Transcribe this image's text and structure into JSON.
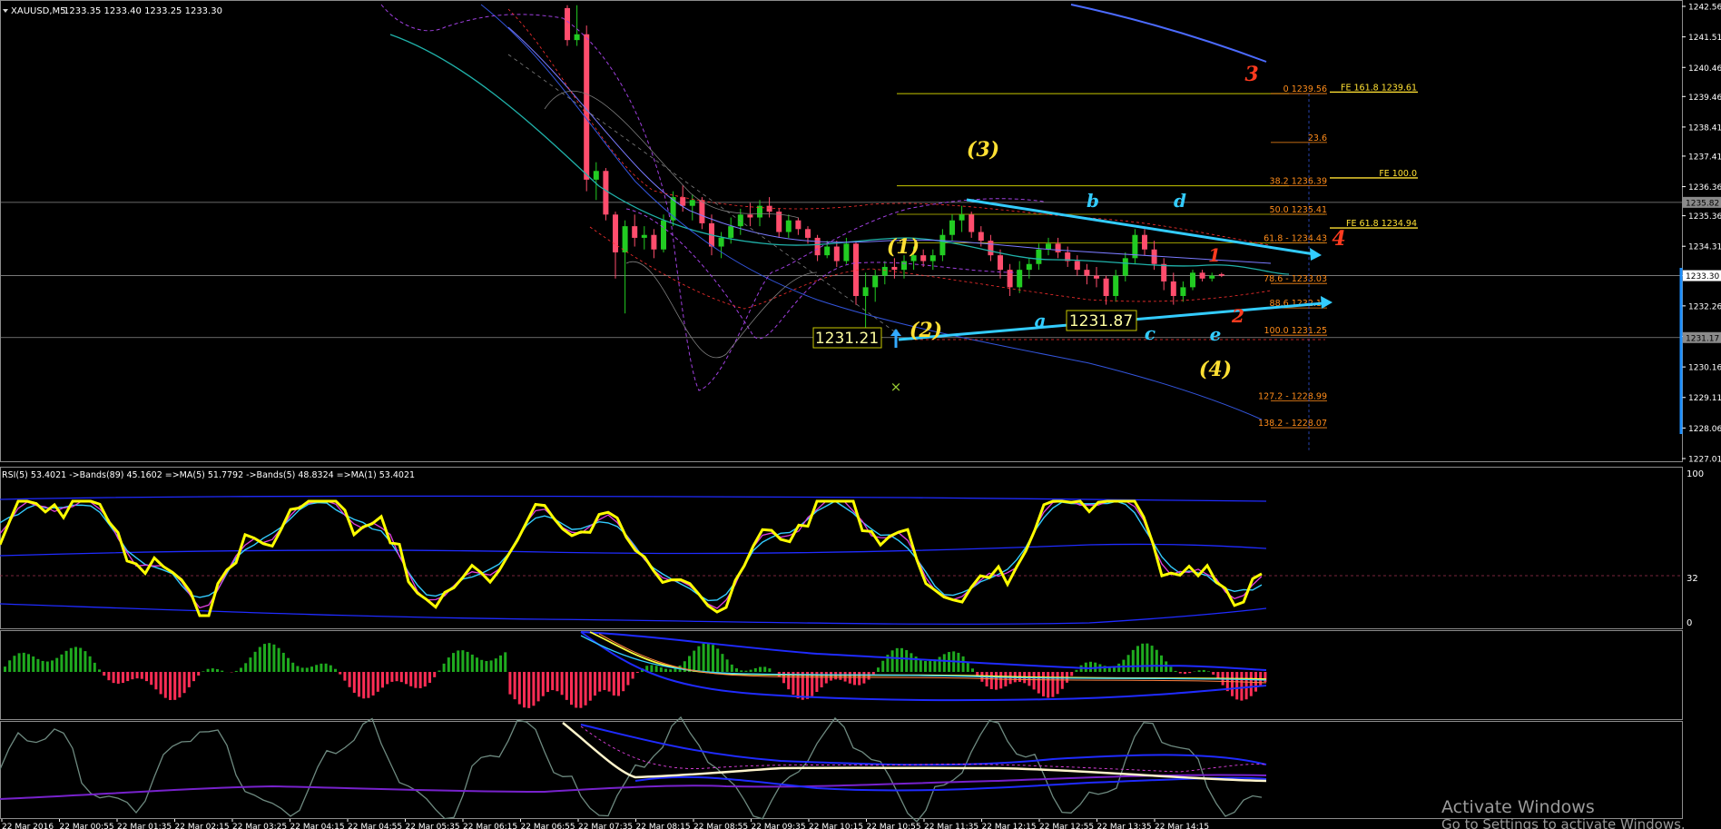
{
  "header": {
    "symbol": "XAUUSD,M5",
    "ohlc": "1233.35 1233.40 1233.25 1233.30"
  },
  "price_axis": {
    "ticks": [
      "1242.56",
      "1241.51",
      "1240.46",
      "1239.46",
      "1238.41",
      "1237.41",
      "1236.36",
      "1235.36",
      "1234.31",
      "1233.30",
      "1232.26",
      "1231.21",
      "1230.16",
      "1229.11",
      "1228.06",
      "1227.01"
    ],
    "current_price_tag": "1233.30",
    "line_tags": [
      "1235.82",
      "1231.17"
    ]
  },
  "fib_retracement": {
    "levels": [
      {
        "label": "0 1239.56",
        "price": 1239.56
      },
      {
        "label": "23.6",
        "price": 1237.88
      },
      {
        "label": "38.2 1236.39",
        "price": 1236.39
      },
      {
        "label": "50.0 1235.41",
        "price": 1235.41
      },
      {
        "label": "61.8 - 1234.43",
        "price": 1234.43
      },
      {
        "label": "78.6 - 1233.03",
        "price": 1233.03
      },
      {
        "label": "88.6 1232.19",
        "price": 1232.19
      },
      {
        "label": "100.0 1231.25",
        "price": 1231.25
      },
      {
        "label": "127.2 - 1228.99",
        "price": 1228.99
      },
      {
        "label": "138.2 - 1228.07",
        "price": 1228.07
      }
    ]
  },
  "fib_expansion": [
    {
      "label": "FE 161.8 1239.61",
      "price": 1239.61
    },
    {
      "label": "FE 100.0",
      "price": 1236.66
    },
    {
      "label": "FE 61.8 1234.94",
      "price": 1234.94
    }
  ],
  "wave_labels": {
    "yellow": [
      "(3)",
      "(1)",
      "(2)",
      "(4)"
    ],
    "cyan": [
      "b",
      "d",
      "a",
      "c",
      "e"
    ],
    "red": [
      "3",
      "4",
      "1",
      "2"
    ]
  },
  "price_boxes": [
    "1231.21",
    "1231.87"
  ],
  "rsi_panel": {
    "legend": "RSI(5) 53.4021 ->Bands(89) 45.1602 =>MA(5) 51.7792 ->Bands(5) 48.8324 =>MA(1) 53.4021",
    "scale": [
      "100",
      "32",
      "0"
    ]
  },
  "time_axis": {
    "labels": [
      "22 Mar 2016",
      "22 Mar 00:55",
      "22 Mar 01:35",
      "22 Mar 02:15",
      "22 Mar 03:25",
      "22 Mar 04:15",
      "22 Mar 04:55",
      "22 Mar 05:35",
      "22 Mar 06:15",
      "22 Mar 06:55",
      "22 Mar 07:35",
      "22 Mar 08:15",
      "22 Mar 08:55",
      "22 Mar 09:35",
      "22 Mar 10:15",
      "22 Mar 10:55",
      "22 Mar 11:35",
      "22 Mar 12:15",
      "22 Mar 12:55",
      "22 Mar 13:35",
      "22 Mar 14:15"
    ]
  },
  "watermark": {
    "line1": "Activate Windows",
    "line2": "Go to Settings to activate Windows."
  },
  "colors": {
    "background": "#000000",
    "bull": "#22cc22",
    "bear": "#ff4d6d",
    "rsi": "#ffff00",
    "cyan": "#33ccff",
    "fib_line": "#c8c800",
    "fib_text": "#ff8c1a",
    "band": "#1f2bff",
    "wave_yellow": "#ffe033",
    "wave_red": "#ff3b1f"
  },
  "chart_data": {
    "type": "candlestick",
    "title": "XAUUSD,M5",
    "ylim": [
      1227.01,
      1242.56
    ],
    "candles": [
      [
        1242.5,
        1242.6,
        1241.2,
        1241.4
      ],
      [
        1241.4,
        1242.6,
        1241.2,
        1241.6
      ],
      [
        1241.6,
        1241.9,
        1236.2,
        1236.6
      ],
      [
        1236.6,
        1237.2,
        1235.9,
        1236.9
      ],
      [
        1236.9,
        1237.0,
        1235.2,
        1235.4
      ],
      [
        1235.4,
        1235.5,
        1233.2,
        1234.1
      ],
      [
        1234.1,
        1235.2,
        1232.0,
        1235.0
      ],
      [
        1235.0,
        1235.4,
        1234.3,
        1234.6
      ],
      [
        1234.6,
        1235.0,
        1234.2,
        1234.7
      ],
      [
        1234.7,
        1234.9,
        1233.9,
        1234.2
      ],
      [
        1234.2,
        1235.4,
        1234.1,
        1235.2
      ],
      [
        1235.2,
        1236.2,
        1235.0,
        1236.0
      ],
      [
        1236.0,
        1236.4,
        1235.5,
        1235.7
      ],
      [
        1235.7,
        1236.1,
        1235.2,
        1235.9
      ],
      [
        1235.9,
        1236.0,
        1234.9,
        1235.1
      ],
      [
        1235.1,
        1235.4,
        1234.0,
        1234.3
      ],
      [
        1234.3,
        1234.8,
        1233.9,
        1234.6
      ],
      [
        1234.6,
        1235.3,
        1234.4,
        1235.0
      ],
      [
        1235.0,
        1235.6,
        1234.7,
        1235.4
      ],
      [
        1235.4,
        1235.8,
        1235.0,
        1235.3
      ],
      [
        1235.3,
        1235.9,
        1235.0,
        1235.7
      ],
      [
        1235.7,
        1236.0,
        1235.3,
        1235.5
      ],
      [
        1235.5,
        1235.6,
        1234.6,
        1234.8
      ],
      [
        1234.8,
        1235.4,
        1234.6,
        1235.2
      ],
      [
        1235.2,
        1235.3,
        1234.7,
        1234.9
      ],
      [
        1234.9,
        1235.0,
        1234.4,
        1234.6
      ],
      [
        1234.6,
        1234.7,
        1233.8,
        1234.0
      ],
      [
        1234.0,
        1234.5,
        1233.9,
        1234.3
      ],
      [
        1234.3,
        1234.5,
        1233.6,
        1233.8
      ],
      [
        1233.8,
        1234.6,
        1233.7,
        1234.4
      ],
      [
        1234.4,
        1234.5,
        1232.3,
        1232.6
      ],
      [
        1232.6,
        1233.4,
        1231.2,
        1232.9
      ],
      [
        1232.9,
        1233.5,
        1232.4,
        1233.3
      ],
      [
        1233.3,
        1233.8,
        1233.0,
        1233.6
      ],
      [
        1233.6,
        1233.9,
        1233.2,
        1233.5
      ],
      [
        1233.5,
        1234.0,
        1233.2,
        1233.8
      ],
      [
        1233.8,
        1234.3,
        1233.5,
        1234.0
      ],
      [
        1234.0,
        1234.2,
        1233.6,
        1233.8
      ],
      [
        1233.8,
        1234.2,
        1233.5,
        1234.0
      ],
      [
        1234.0,
        1234.9,
        1233.8,
        1234.7
      ],
      [
        1234.7,
        1235.4,
        1234.5,
        1235.2
      ],
      [
        1235.2,
        1235.7,
        1234.8,
        1235.4
      ],
      [
        1235.4,
        1235.5,
        1234.6,
        1234.8
      ],
      [
        1234.8,
        1235.0,
        1234.3,
        1234.5
      ],
      [
        1234.5,
        1234.7,
        1233.8,
        1234.0
      ],
      [
        1234.0,
        1234.2,
        1233.2,
        1233.5
      ],
      [
        1233.5,
        1233.7,
        1232.6,
        1232.9
      ],
      [
        1232.9,
        1233.8,
        1232.7,
        1233.5
      ],
      [
        1233.5,
        1233.9,
        1233.2,
        1233.7
      ],
      [
        1233.7,
        1234.4,
        1233.5,
        1234.2
      ],
      [
        1234.2,
        1234.6,
        1234.0,
        1234.4
      ],
      [
        1234.4,
        1234.6,
        1233.9,
        1234.1
      ],
      [
        1234.1,
        1234.3,
        1233.6,
        1233.8
      ],
      [
        1233.8,
        1234.0,
        1233.3,
        1233.5
      ],
      [
        1233.5,
        1233.7,
        1233.0,
        1233.3
      ],
      [
        1233.3,
        1233.6,
        1232.9,
        1233.2
      ],
      [
        1233.2,
        1233.3,
        1232.3,
        1232.6
      ],
      [
        1232.6,
        1233.5,
        1232.4,
        1233.3
      ],
      [
        1233.3,
        1234.1,
        1233.1,
        1233.9
      ],
      [
        1233.9,
        1234.9,
        1233.7,
        1234.7
      ],
      [
        1234.7,
        1234.9,
        1234.0,
        1234.2
      ],
      [
        1234.2,
        1234.5,
        1233.5,
        1233.7
      ],
      [
        1233.7,
        1233.9,
        1232.8,
        1233.1
      ],
      [
        1233.1,
        1233.4,
        1232.3,
        1232.6
      ],
      [
        1232.6,
        1233.1,
        1232.4,
        1232.9
      ],
      [
        1232.9,
        1233.5,
        1232.8,
        1233.4
      ],
      [
        1233.4,
        1233.5,
        1233.1,
        1233.2
      ],
      [
        1233.2,
        1233.4,
        1233.1,
        1233.3
      ],
      [
        1233.35,
        1233.4,
        1233.25,
        1233.3
      ]
    ]
  }
}
